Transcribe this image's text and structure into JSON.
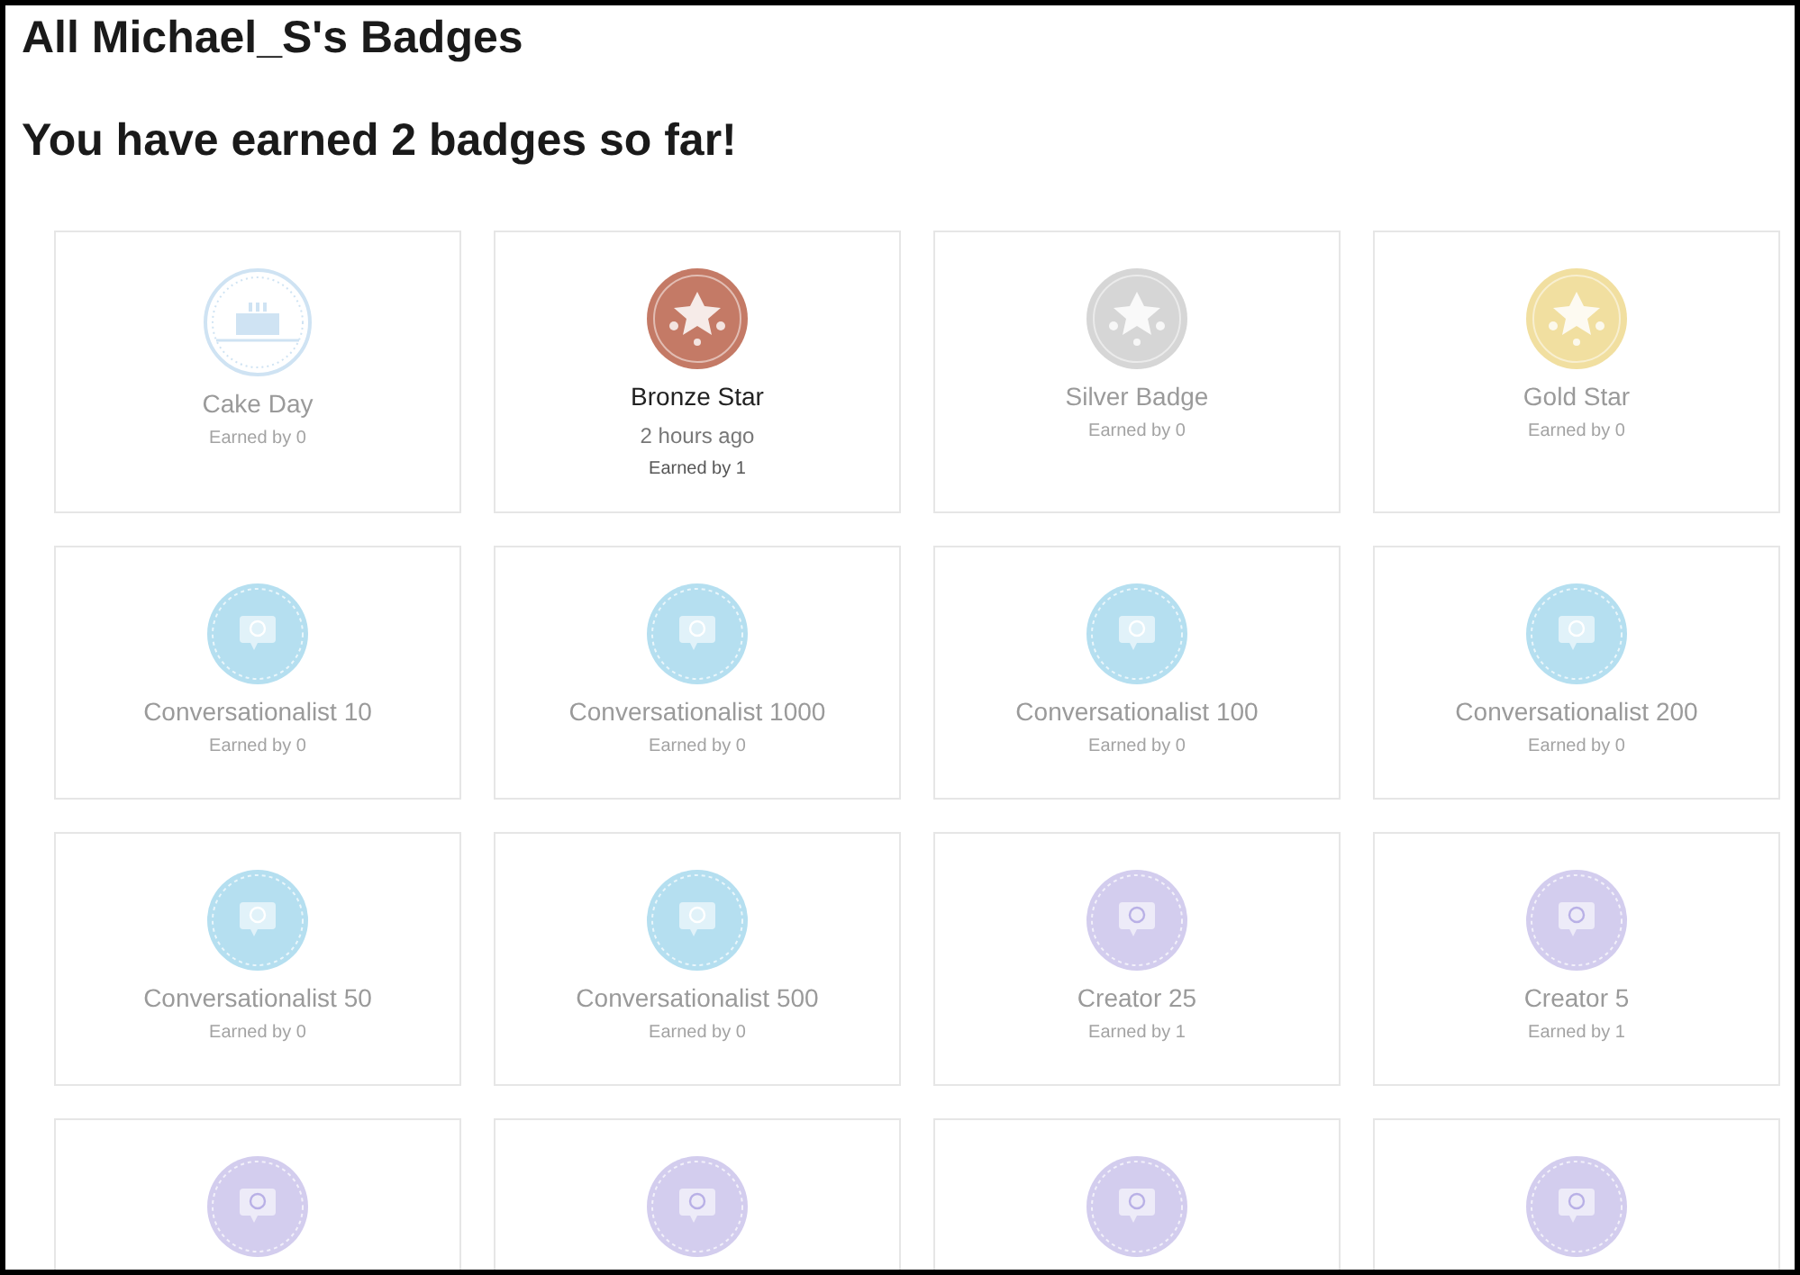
{
  "title": "All Michael_S's Badges",
  "subtitle": "You have earned 2 badges so far!",
  "badges": [
    {
      "kind": "cake",
      "color": "#cfe3f3",
      "name": "Cake Day",
      "earned": false,
      "earned_by": "Earned by 0"
    },
    {
      "kind": "star",
      "color": "#c47a66",
      "name": "Bronze Star",
      "earned": true,
      "date": "2 hours ago",
      "earned_by": "Earned by 1"
    },
    {
      "kind": "star",
      "color": "#d6d6d6",
      "name": "Silver Badge",
      "earned": false,
      "earned_by": "Earned by 0"
    },
    {
      "kind": "star",
      "color": "#f1dfa0",
      "name": "Gold Star",
      "earned": false,
      "earned_by": "Earned by 0"
    },
    {
      "kind": "chat",
      "color": "#b5dff0",
      "name": "Conversationalist 10",
      "earned": false,
      "earned_by": "Earned by 0"
    },
    {
      "kind": "chat",
      "color": "#b5dff0",
      "name": "Conversationalist 1000",
      "earned": false,
      "earned_by": "Earned by 0"
    },
    {
      "kind": "chat",
      "color": "#b5dff0",
      "name": "Conversationalist 100",
      "earned": false,
      "earned_by": "Earned by 0"
    },
    {
      "kind": "chat",
      "color": "#b5dff0",
      "name": "Conversationalist 200",
      "earned": false,
      "earned_by": "Earned by 0"
    },
    {
      "kind": "chat",
      "color": "#b5dff0",
      "name": "Conversationalist 50",
      "earned": false,
      "earned_by": "Earned by 0"
    },
    {
      "kind": "chat",
      "color": "#b5dff0",
      "name": "Conversationalist 500",
      "earned": false,
      "earned_by": "Earned by 0"
    },
    {
      "kind": "creator",
      "color": "#d3cdee",
      "name": "Creator 25",
      "earned": false,
      "earned_by": "Earned by 1"
    },
    {
      "kind": "creator",
      "color": "#d3cdee",
      "name": "Creator 5",
      "earned": false,
      "earned_by": "Earned by 1"
    },
    {
      "kind": "creator",
      "color": "#d3cdee"
    },
    {
      "kind": "creator",
      "color": "#d3cdee"
    },
    {
      "kind": "creator",
      "color": "#d3cdee"
    },
    {
      "kind": "creator",
      "color": "#d3cdee"
    }
  ]
}
